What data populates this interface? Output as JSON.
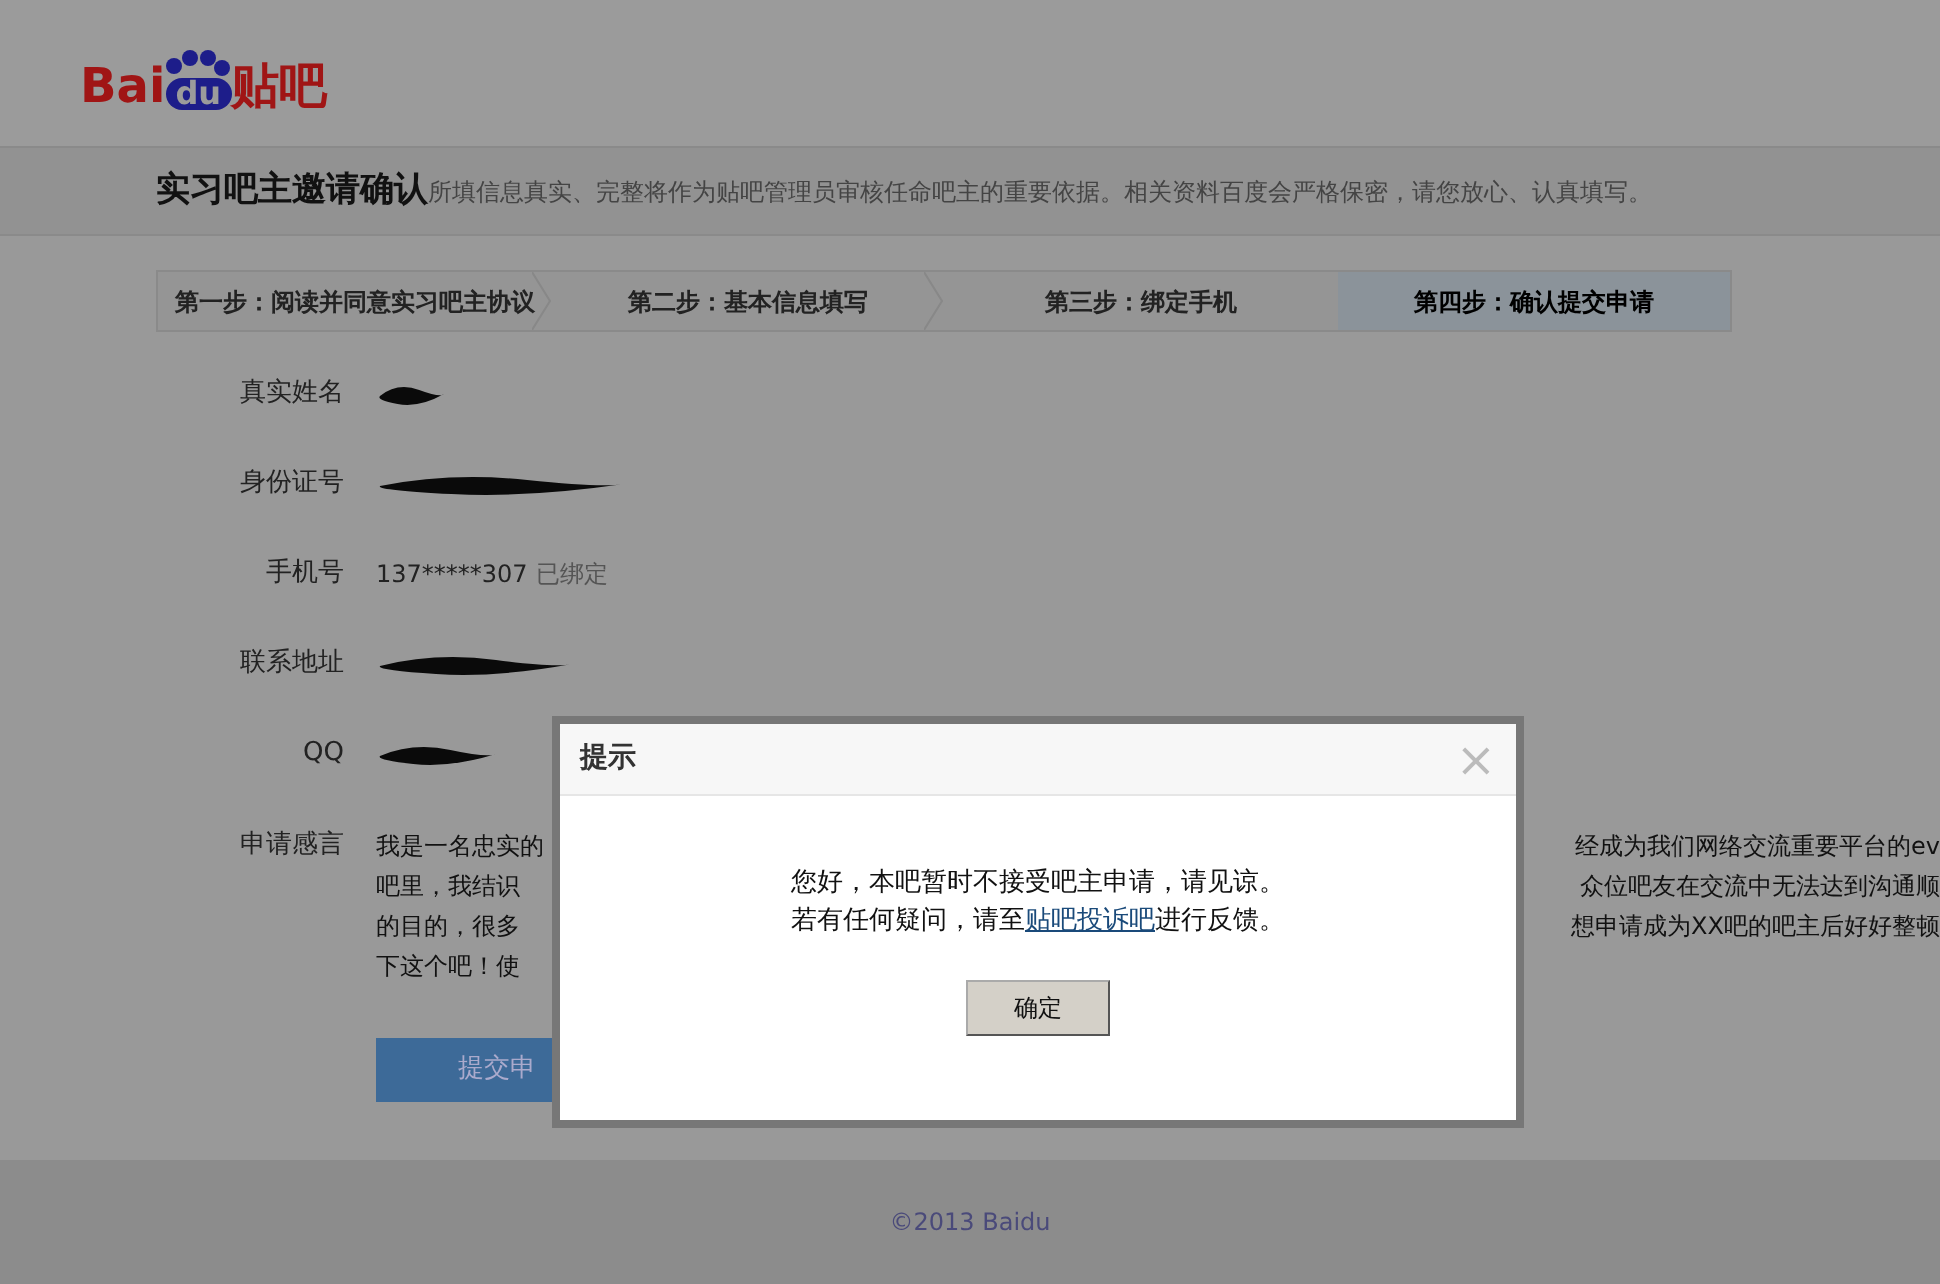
{
  "logo": {
    "latin": "Bai",
    "paw": "du",
    "chinese": "贴吧"
  },
  "header": {
    "title": "实习吧主邀请确认",
    "subtitle": "所填信息真实、完整将作为贴吧管理员审核任命吧主的重要依据。相关资料百度会严格保密，请您放心、认真填写。"
  },
  "steps": [
    {
      "label": "第一步：阅读并同意实习吧主协议",
      "selected": false
    },
    {
      "label": "第二步：基本信息填写",
      "selected": false
    },
    {
      "label": "第三步：绑定手机",
      "selected": false
    },
    {
      "label": "第四步：确认提交申请",
      "selected": true
    }
  ],
  "fields": [
    {
      "label": "真实姓名",
      "kind": "redacted"
    },
    {
      "label": "身份证号",
      "kind": "redacted"
    },
    {
      "label": "手机号",
      "kind": "text",
      "value": "137*****307",
      "note": "已绑定"
    },
    {
      "label": "联系地址",
      "kind": "redacted"
    },
    {
      "label": "QQ",
      "kind": "redacted"
    }
  ],
  "statement": {
    "label": "申请感言",
    "lines": [
      {
        "left": "我是一名忠实的",
        "right": "经成为我们网络交流重要平台的ev"
      },
      {
        "left": "吧里，我结识",
        "right": "众位吧友在交流中无法达到沟通顺"
      },
      {
        "left": "的目的，很多",
        "right": "想申请成为XX吧的吧主后好好整顿"
      },
      {
        "left": "下这个吧！使"
      }
    ]
  },
  "submit_button": "提交申",
  "footer": "©2013 Baidu",
  "dialog": {
    "title": "提示",
    "close": "×",
    "message_line1": "您好，本吧暂时不接受吧主申请，请见谅。",
    "message_line2_before": "若有任何疑问，请至",
    "link": "贴吧投诉吧",
    "message_line2_after": "进行反馈。",
    "ok_button": "确定"
  }
}
